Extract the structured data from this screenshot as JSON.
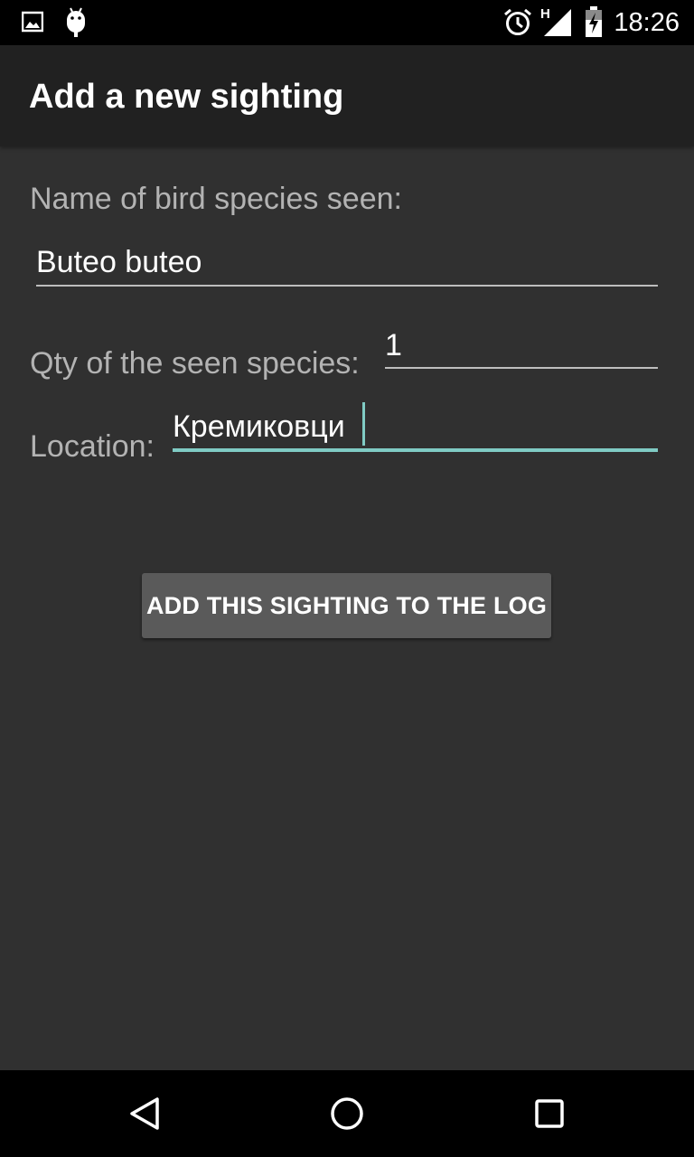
{
  "status_bar": {
    "time": "18:26",
    "network_type": "H",
    "left_icons": [
      "image-icon",
      "android-debug-icon"
    ],
    "right_icons": [
      "alarm-icon",
      "signal-icon",
      "battery-charging-icon"
    ]
  },
  "action_bar": {
    "title": "Add a new sighting"
  },
  "form": {
    "species_label": "Name of bird species seen:",
    "species_value": "Buteo buteo",
    "qty_label": "Qty of the seen species:",
    "qty_value": "1",
    "location_label": "Location:",
    "location_value": "Кремиковци",
    "submit_label": "ADD THIS SIGHTING TO THE LOG"
  },
  "nav_bar": {
    "icons": [
      "back-icon",
      "home-icon",
      "recents-icon"
    ]
  },
  "colors": {
    "background": "#303030",
    "action_bar": "#212121",
    "accent": "#80cbc4",
    "button": "#5a5a5a"
  }
}
